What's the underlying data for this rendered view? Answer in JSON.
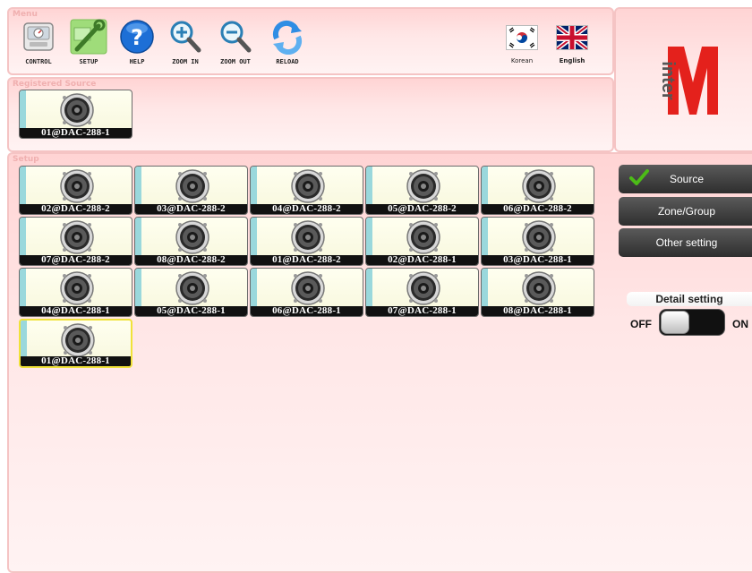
{
  "menu": {
    "title": "Menu",
    "buttons": [
      {
        "label": "CONTROL",
        "icon": "control-panel-icon"
      },
      {
        "label": "SETUP",
        "icon": "wrench-settings-icon"
      },
      {
        "label": "HELP",
        "icon": "help-question-icon"
      },
      {
        "label": "ZOOM IN",
        "icon": "zoom-in-icon"
      },
      {
        "label": "ZOOM OUT",
        "icon": "zoom-out-icon"
      },
      {
        "label": "RELOAD",
        "icon": "reload-icon"
      }
    ],
    "languages": [
      {
        "label": "Korean",
        "icon": "korea-flag-icon"
      },
      {
        "label": "English",
        "icon": "uk-flag-icon"
      }
    ]
  },
  "logo": {
    "text": "inter",
    "letter": "M"
  },
  "registered": {
    "title": "Registered Source",
    "items": [
      "01@DAC-288-1"
    ]
  },
  "setup": {
    "title": "Setup",
    "items": [
      "02@DAC-288-2",
      "03@DAC-288-2",
      "04@DAC-288-2",
      "05@DAC-288-2",
      "06@DAC-288-2",
      "07@DAC-288-2",
      "08@DAC-288-2",
      "01@DAC-288-2",
      "02@DAC-288-1",
      "03@DAC-288-1",
      "04@DAC-288-1",
      "05@DAC-288-1",
      "06@DAC-288-1",
      "07@DAC-288-1",
      "08@DAC-288-1",
      "01@DAC-288-1"
    ],
    "selected_index": 15
  },
  "side": {
    "buttons": [
      "Source",
      "Zone/Group",
      "Other setting"
    ],
    "active": "Source"
  },
  "detail": {
    "title": "Detail setting",
    "off_label": "OFF",
    "on_label": "ON",
    "state": "OFF"
  },
  "colors": {
    "panel_bg": "#ffe0e0",
    "logo_red": "#e4211c",
    "tile_strip": "#9ad8dc",
    "selected_border": "#f0e23a",
    "check_green": "#4cbb17"
  }
}
